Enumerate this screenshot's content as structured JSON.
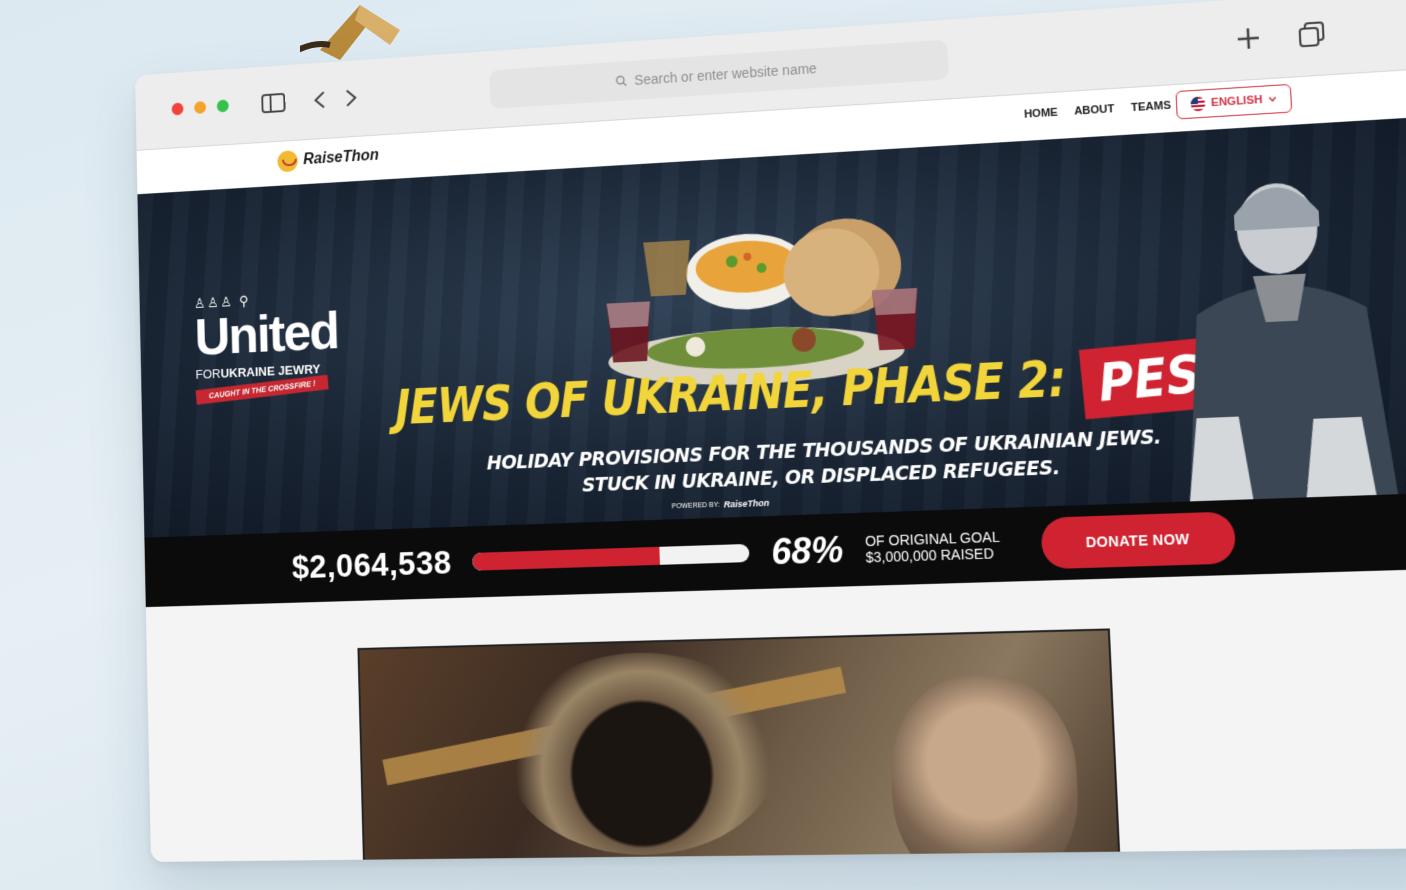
{
  "browser": {
    "address_placeholder": "Search or enter website name"
  },
  "site": {
    "logo_text": "RaiseThon",
    "nav": [
      "HOME",
      "ABOUT",
      "TEAMS"
    ],
    "language": "ENGLISH"
  },
  "hero": {
    "united_word": "United",
    "united_for": "FOR",
    "united_org": "UKRAINE JEWRY",
    "united_tag": "CAUGHT IN THE CROSSFIRE !",
    "headline": "JEWS OF UKRAINE, PHASE 2:",
    "headline_tag": "PESACH!",
    "subline_1": "HOLIDAY PROVISIONS FOR THE THOUSANDS OF UKRAINIAN JEWS.",
    "subline_2": "STUCK IN UKRAINE, OR DISPLACED REFUGEES.",
    "powered_by": "POWERED BY:",
    "powered_brand": "RaiseThon"
  },
  "stats": {
    "raised": "$2,064,538",
    "progress_percent": 68,
    "percent_label": "68%",
    "goal_line_1": "OF ORIGINAL GOAL",
    "goal_line_2": "$3,000,000 RAISED",
    "donate_label": "DONATE NOW"
  },
  "colors": {
    "accent_red": "#cf2332",
    "headline_yellow": "#f2d43b",
    "hero_bg": "#1a2636"
  }
}
